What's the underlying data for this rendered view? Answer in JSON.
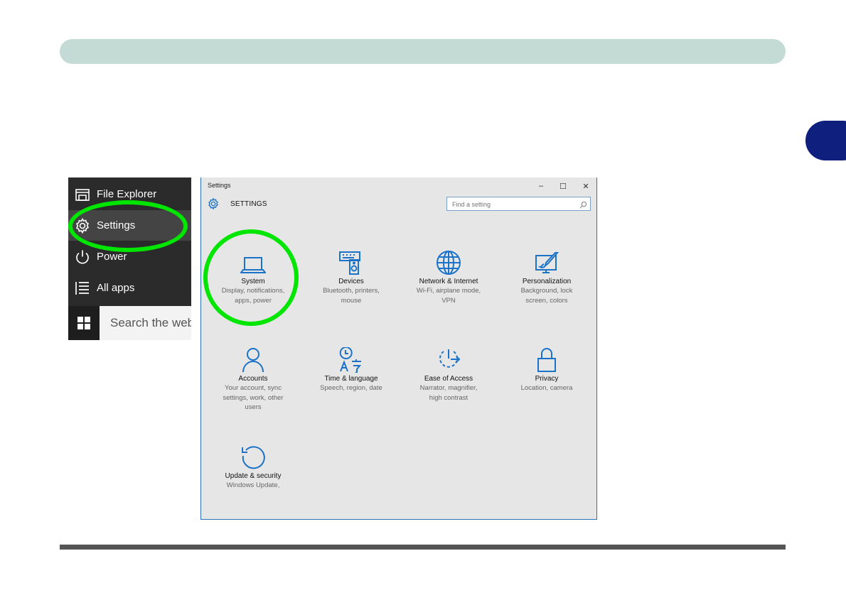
{
  "start_menu": {
    "items": [
      {
        "label": "File Explorer",
        "icon": "folder-icon"
      },
      {
        "label": "Settings",
        "icon": "gear-icon"
      },
      {
        "label": "Power",
        "icon": "power-icon"
      },
      {
        "label": "All apps",
        "icon": "list-icon"
      }
    ],
    "search_placeholder": "Search the web"
  },
  "window": {
    "title": "Settings",
    "controls": {
      "minimize": "–",
      "maximize": "☐",
      "close": "✕"
    }
  },
  "header": {
    "title": "SETTINGS",
    "search_placeholder": "Find a setting"
  },
  "tiles": [
    {
      "name": "System",
      "desc": [
        "Display, notifications,",
        "apps, power"
      ],
      "icon": "laptop-icon"
    },
    {
      "name": "Devices",
      "desc": [
        "Bluetooth, printers,",
        "mouse"
      ],
      "icon": "devices-icon"
    },
    {
      "name": "Network & Internet",
      "desc": [
        "Wi-Fi, airplane mode,",
        "VPN"
      ],
      "icon": "globe-icon"
    },
    {
      "name": "Personalization",
      "desc": [
        "Background, lock",
        "screen, colors"
      ],
      "icon": "paint-icon"
    },
    {
      "name": "Accounts",
      "desc": [
        "Your account, sync",
        "settings, work, other",
        "users"
      ],
      "icon": "person-icon"
    },
    {
      "name": "Time & language",
      "desc": [
        "Speech, region, date"
      ],
      "icon": "time-language-icon"
    },
    {
      "name": "Ease of Access",
      "desc": [
        "Narrator, magnifier,",
        "high contrast"
      ],
      "icon": "ease-of-access-icon"
    },
    {
      "name": "Privacy",
      "desc": [
        "Location, camera"
      ],
      "icon": "lock-icon"
    },
    {
      "name": "Update & security",
      "desc": [
        "Windows Update,"
      ],
      "icon": "refresh-icon"
    }
  ],
  "colors": {
    "accent": "#1a73c8",
    "highlight": "#00e600",
    "header_band": "#c3dbd4",
    "chapter_tab": "#0f1f7e"
  }
}
